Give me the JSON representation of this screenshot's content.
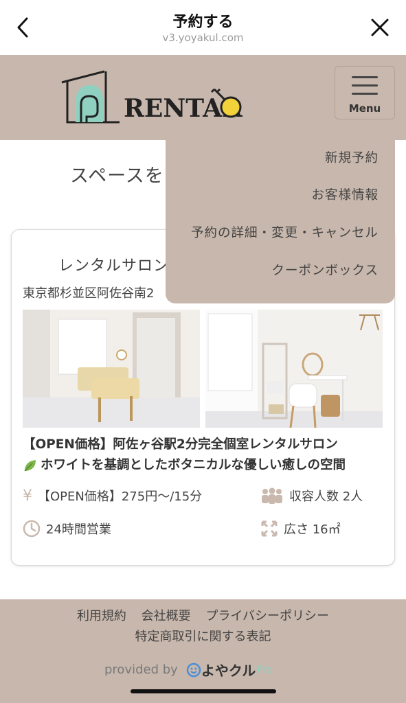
{
  "header": {
    "title": "予約する",
    "url": "v3.yoyakul.com"
  },
  "site": {
    "logo_text": "RENTARO",
    "menu_label": "Menu"
  },
  "page": {
    "heading": "スペースを"
  },
  "menu_items": [
    "新規予約",
    "お客様情報",
    "予約の詳細・変更・キャンセル",
    "クーポンボックス"
  ],
  "card": {
    "title": "レンタルサロン",
    "address": "東京都杉並区阿佐谷南2",
    "desc_line1": "【OPEN価格】阿佐ヶ谷駅2分完全個室レンタルサロン",
    "desc_line2": "ホワイトを基調としたボタニカルな優しい癒しの空間",
    "price": "【OPEN価格】275円〜/15分",
    "capacity": "収容人数 2人",
    "hours": "24時間営業",
    "area": "広さ 16㎡"
  },
  "footer": {
    "links": [
      "利用規約",
      "会社概要",
      "プライバシーポリシー"
    ],
    "link2": "特定商取引に関する表記",
    "provided_by": "provided by",
    "brand": "よやクル",
    "brand_suffix": "Pro"
  },
  "colors": {
    "accent": "#c8b7ac",
    "logo_teal": "#8fd0c0",
    "key_yellow": "#f2d23a"
  }
}
